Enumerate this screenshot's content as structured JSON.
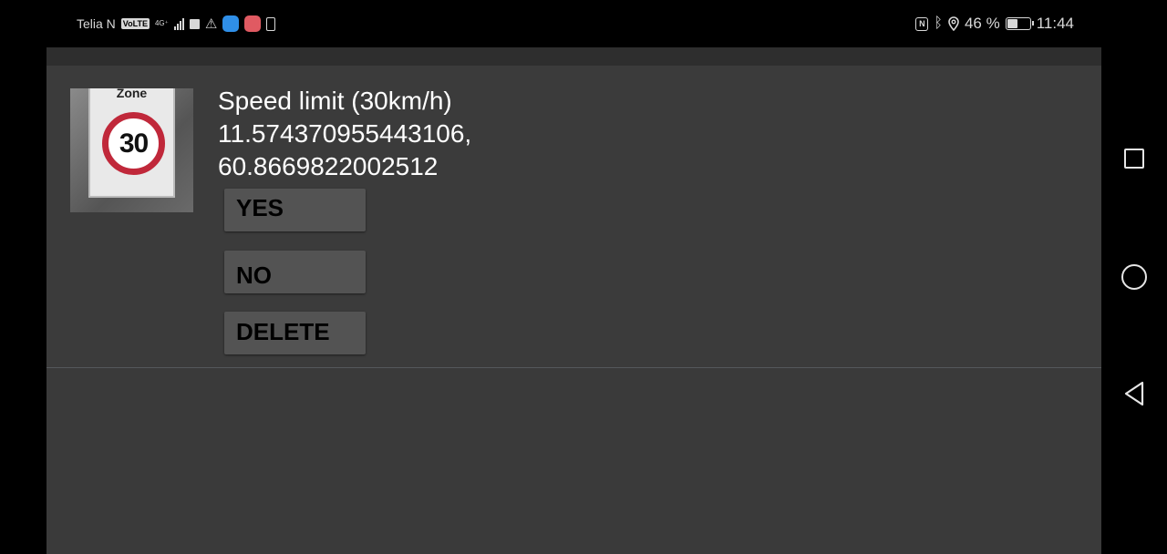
{
  "status_bar": {
    "carrier": "Telia N",
    "volte": "VoLTE",
    "network": "4G⁺",
    "battery_percent_label": "46 %",
    "battery_level": 0.46,
    "time": "11:44",
    "icons": [
      "volte-icon",
      "signal-icon",
      "square-notification-icon",
      "warning-icon",
      "blue-app-icon",
      "red-app-icon",
      "phone-vibrate-icon",
      "nfc-icon",
      "bluetooth-icon",
      "location-icon",
      "battery-icon"
    ]
  },
  "detection": {
    "thumbnail_sign_text": "Zone",
    "thumbnail_sign_value": "30",
    "label": "Speed limit (30km/h)",
    "longitude": "11.574370955443106,",
    "latitude": "60.8669822002512"
  },
  "buttons": {
    "yes": "YES",
    "no": "NO",
    "delete": "DELETE"
  },
  "nav": {
    "icons": [
      "recents-square-icon",
      "home-circle-icon",
      "back-triangle-icon"
    ]
  },
  "colors": {
    "app_background": "#3a3a3a",
    "button_background": "#535353",
    "sign_ring": "#c0283a"
  }
}
